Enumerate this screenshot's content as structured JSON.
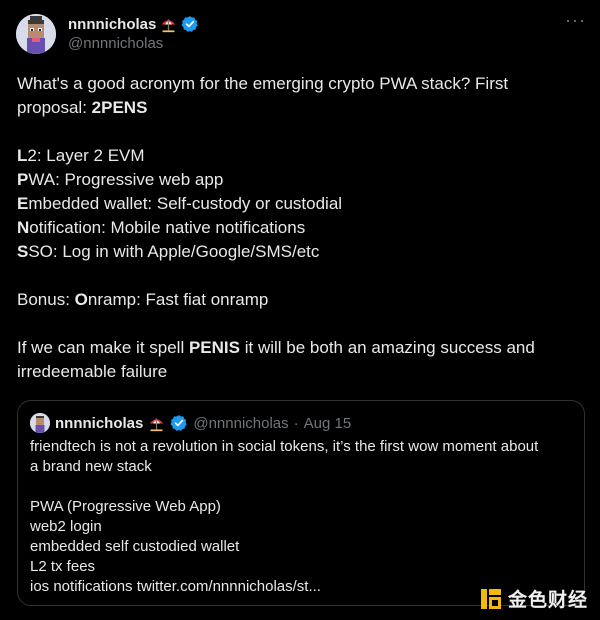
{
  "author": {
    "display_name": "nnnnicholas",
    "handle": "@nnnnicholas",
    "emoji": "umbrella-on-ground",
    "verified": true
  },
  "tweet": {
    "line1": "What's a good acronym for the emerging crypto PWA stack?  First",
    "line2_prefix": "proposal: ",
    "line2_bold": "2PENS",
    "items": [
      {
        "bold": "L",
        "rest": "2: Layer 2 EVM"
      },
      {
        "bold": "P",
        "rest": "WA: Progressive web app"
      },
      {
        "bold": "E",
        "rest": "mbedded wallet:  Self-custody or custodial"
      },
      {
        "bold": "N",
        "rest": "otification: Mobile native notifications"
      },
      {
        "bold": "S",
        "rest": "SO: Log in with Apple/Google/SMS/etc"
      }
    ],
    "bonus_prefix": "Bonus: ",
    "bonus_bold": "O",
    "bonus_rest": "nramp: Fast fiat onramp",
    "closing_prefix": "If we can make it spell ",
    "closing_bold": "PENIS",
    "closing_rest": " it will be both an amazing success and",
    "closing_line2": "irredeemable failure"
  },
  "quote": {
    "display_name": "nnnnicholas",
    "handle": "@nnnnicholas",
    "separator": "·",
    "date": "Aug 15",
    "text_line1": "friendtech is not a revolution in social tokens, it’s the first wow moment about",
    "text_line2": "a brand new stack",
    "list": [
      "PWA (Progressive Web App)",
      "web2 login",
      "embedded self custodied wallet",
      "L2 tx fees",
      "ios notifications twitter.com/nnnnicholas/st..."
    ]
  },
  "watermark": {
    "text": "金色财经",
    "color": "#f0b90b"
  },
  "colors": {
    "background": "#000000",
    "text": "#e7e9ea",
    "muted": "#71767b",
    "verified": "#1d9bf0",
    "border": "#2f3336"
  }
}
